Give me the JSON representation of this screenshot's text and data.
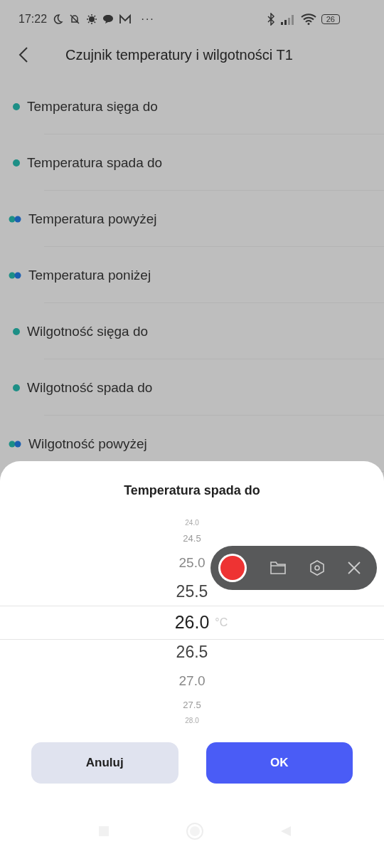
{
  "status_bar": {
    "time": "17:22",
    "more": "···",
    "battery": "26"
  },
  "header": {
    "title": "Czujnik temperatury i wilgotności T1"
  },
  "conditions": [
    {
      "label": "Temperatura sięga do",
      "kind": "single"
    },
    {
      "label": "Temperatura spada do",
      "kind": "single"
    },
    {
      "label": "Temperatura powyżej",
      "kind": "double"
    },
    {
      "label": "Temperatura poniżej",
      "kind": "double"
    },
    {
      "label": "Wilgotność sięga do",
      "kind": "single"
    },
    {
      "label": "Wilgotność spada do",
      "kind": "single"
    },
    {
      "label": "Wilgotność powyżej",
      "kind": "double"
    }
  ],
  "sheet": {
    "title": "Temperatura spada do",
    "unit": "°C",
    "values": [
      {
        "label": "24.0",
        "selected": false
      },
      {
        "label": "24.5",
        "selected": false
      },
      {
        "label": "25.0",
        "selected": false
      },
      {
        "label": "25.5",
        "selected": false
      },
      {
        "label": "26.0",
        "selected": true
      },
      {
        "label": "26.5",
        "selected": false
      },
      {
        "label": "27.0",
        "selected": false
      },
      {
        "label": "27.5",
        "selected": false
      },
      {
        "label": "28.0",
        "selected": false
      }
    ],
    "buttons": [
      {
        "label": "Anuluj",
        "kind": "secondary"
      },
      {
        "label": "OK",
        "kind": "primary"
      }
    ]
  }
}
